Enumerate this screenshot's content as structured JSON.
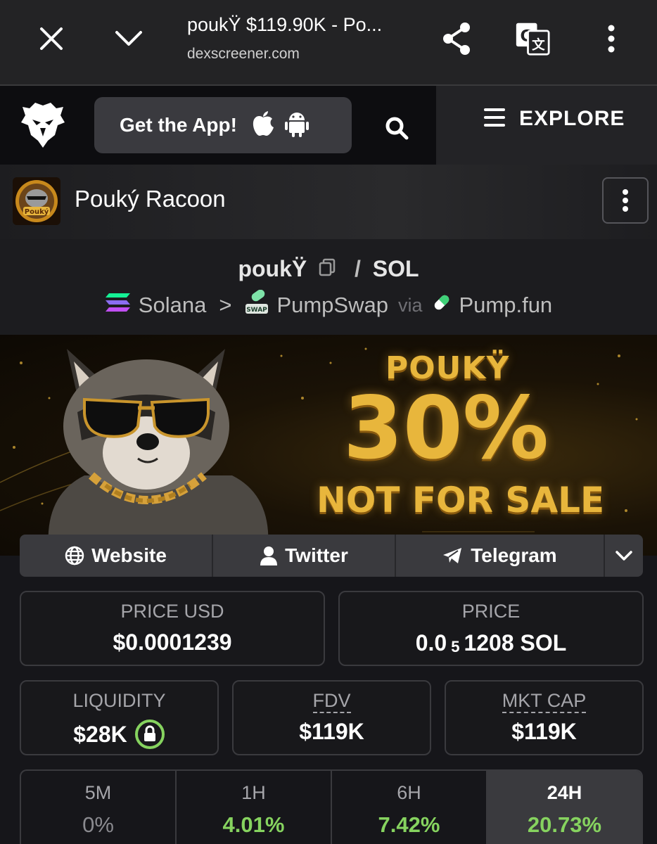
{
  "browser": {
    "title": "poukŸ $119.90K - Po...",
    "url": "dexscreener.com"
  },
  "header": {
    "get_app_label": "Get the App!",
    "explore_label": "EXPLORE"
  },
  "token": {
    "name": "Pouký Racoon",
    "avatar_text": "Pouký"
  },
  "pair": {
    "base": "poukŸ",
    "separator": "/",
    "quote": "SOL",
    "chain": "Solana",
    "chevron": ">",
    "dex": "PumpSwap",
    "dex_badge": "SWAP",
    "via": "via",
    "launchpad": "Pump.fun"
  },
  "banner": {
    "line1": "POUKŸ",
    "line2": "30%",
    "line3": "NOT FOR SALE"
  },
  "links": {
    "website": "Website",
    "twitter": "Twitter",
    "telegram": "Telegram"
  },
  "stats": {
    "price_usd_label": "PRICE USD",
    "price_usd_value": "$0.0001239",
    "price_label": "PRICE",
    "price_prefix": "0.0",
    "price_subscript": "5",
    "price_suffix": "1208 SOL",
    "liquidity_label": "LIQUIDITY",
    "liquidity_value": "$28K",
    "fdv_label": "FDV",
    "fdv_value": "$119K",
    "mktcap_label": "MKT CAP",
    "mktcap_value": "$119K"
  },
  "changes": [
    {
      "label": "5M",
      "value": "0%",
      "color": "#8a8a8f"
    },
    {
      "label": "1H",
      "value": "4.01%",
      "color": "#86d35f"
    },
    {
      "label": "6H",
      "value": "7.42%",
      "color": "#86d35f"
    },
    {
      "label": "24H",
      "value": "20.73%",
      "color": "#86d35f"
    }
  ],
  "colors": {
    "positive": "#86d35f",
    "neutral": "#8a8a8f",
    "banner_gold": "#e8b63c"
  }
}
